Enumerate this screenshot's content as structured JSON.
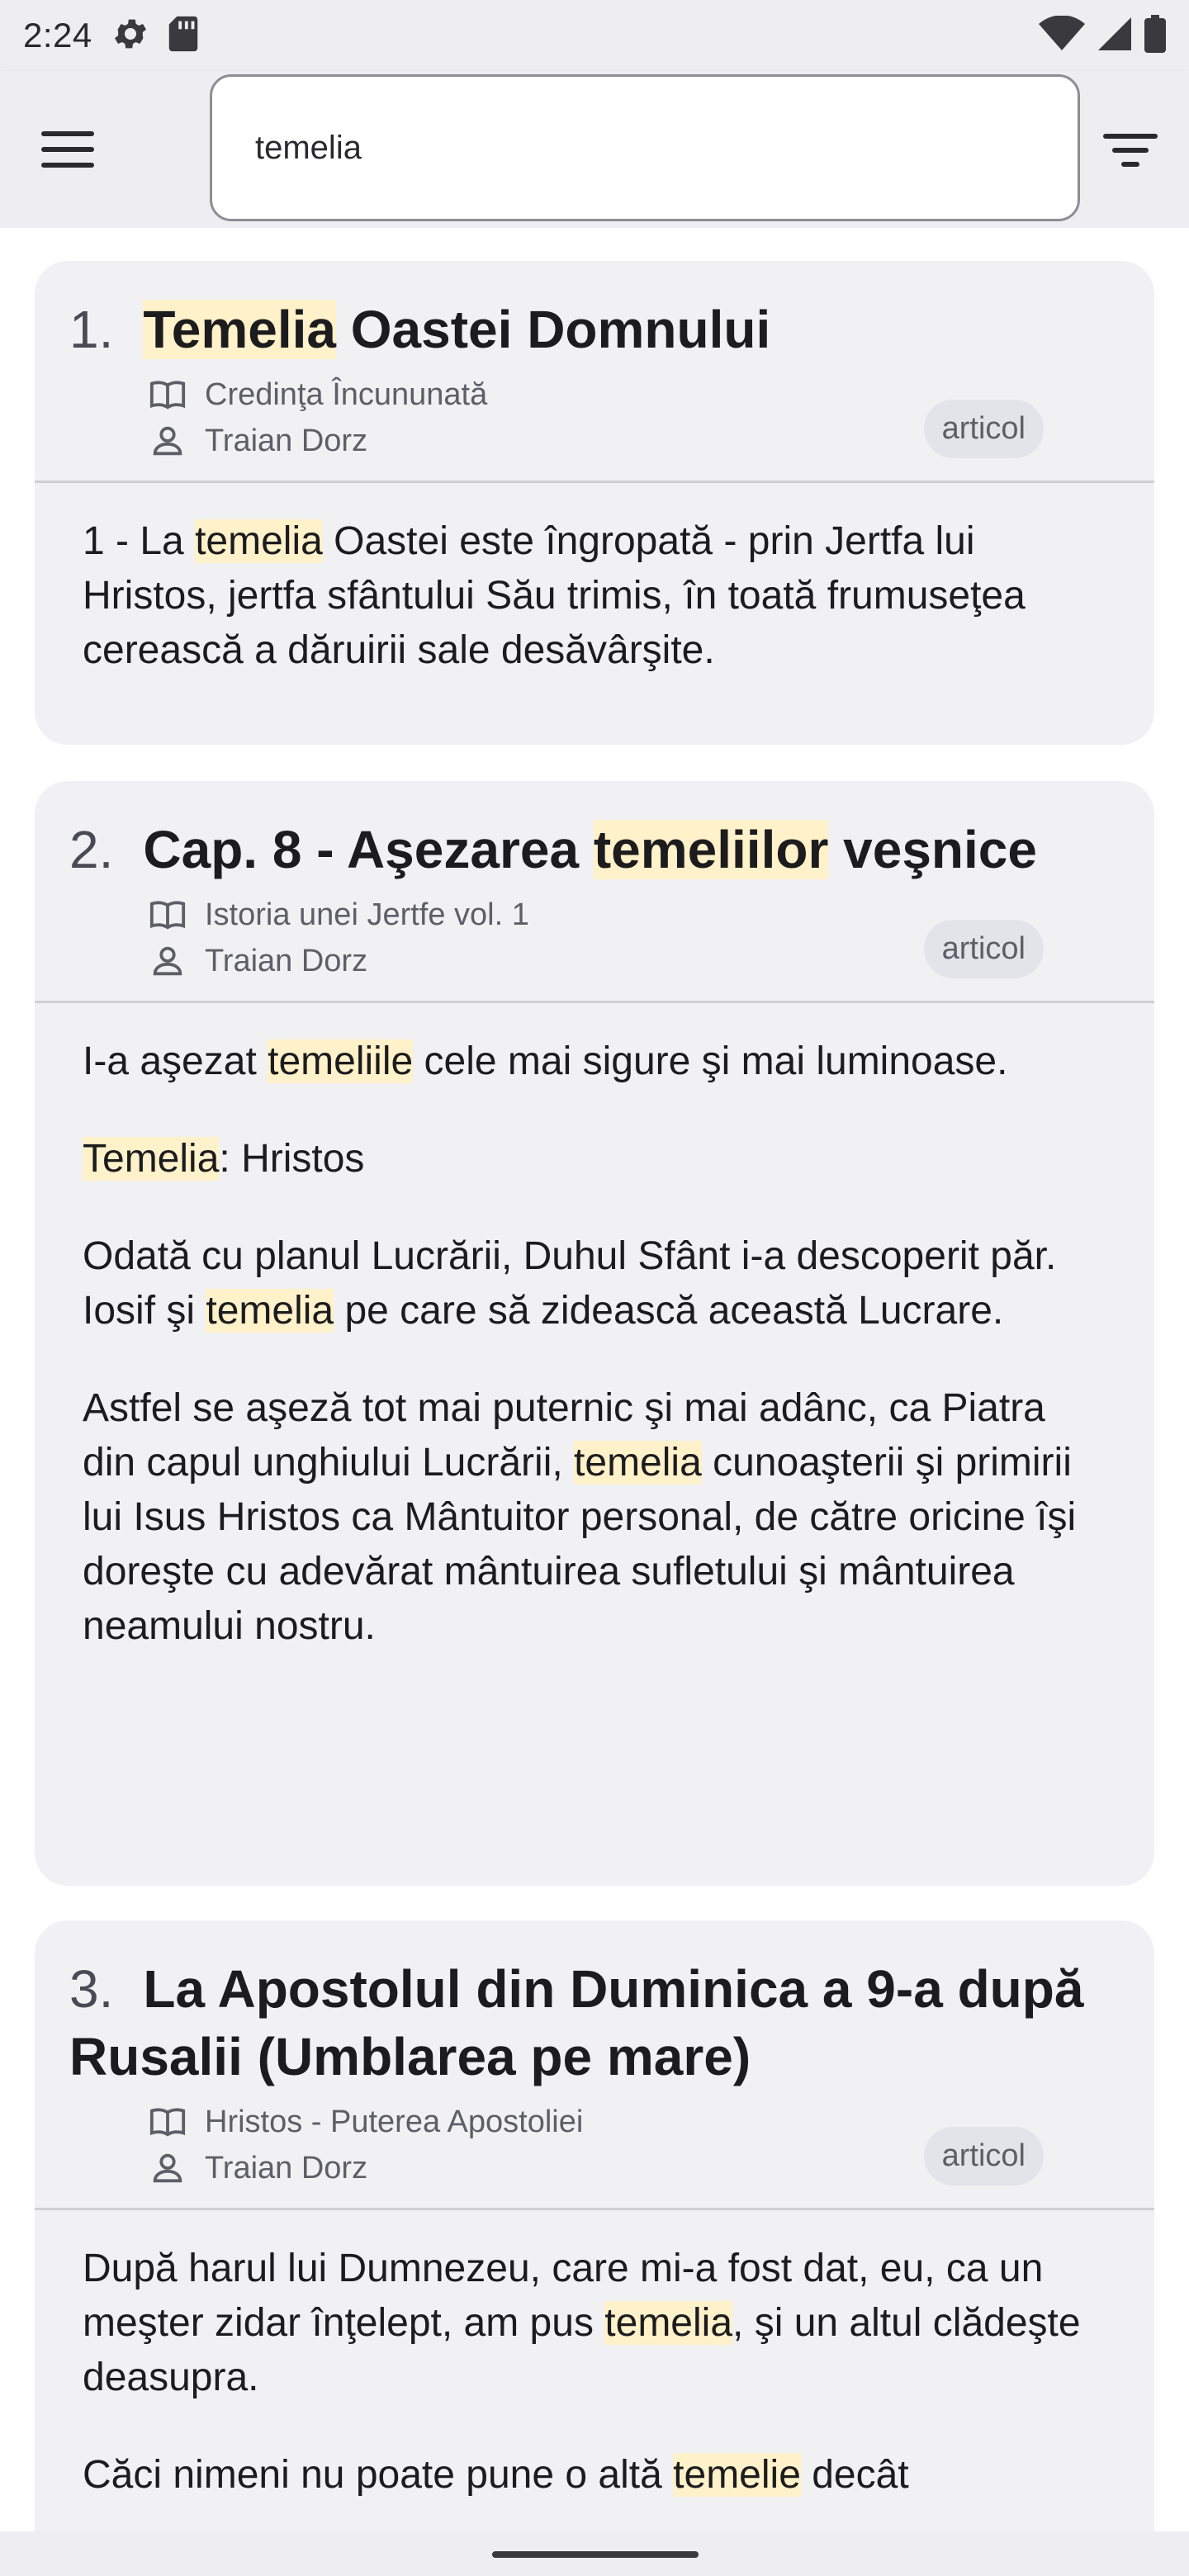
{
  "status_bar": {
    "time": "2:24",
    "left_icons": [
      "settings-gear-icon",
      "sd-card-icon"
    ],
    "right_icons": [
      "wifi-icon",
      "cell-signal-icon",
      "battery-icon"
    ]
  },
  "app_bar": {
    "menu_icon": "hamburger-menu-icon",
    "search_value": "temelia",
    "filter_icon": "filter-icon"
  },
  "results": [
    {
      "number": "1.",
      "title_parts": [
        {
          "text": "Temelia",
          "highlight": true
        },
        {
          "text": " Oastei Domnului",
          "highlight": false
        }
      ],
      "book": "Credinţa Încununată",
      "author": "Traian Dorz",
      "badge": "articol",
      "paragraphs": [
        [
          {
            "text": "1 - La ",
            "highlight": false
          },
          {
            "text": "temelia",
            "highlight": true
          },
          {
            "text": " Oastei este îngropată - prin Jertfa lui Hristos, jertfa sfântului Său trimis, în toată frumuseţea cerească a dăruirii sale desăvârşite.",
            "highlight": false
          }
        ]
      ]
    },
    {
      "number": "2.",
      "title_parts": [
        {
          "text": "Cap. 8 - Aşezarea ",
          "highlight": false
        },
        {
          "text": "temeliilor",
          "highlight": true
        },
        {
          "text": " veşnice",
          "highlight": false
        }
      ],
      "book": "Istoria unei Jertfe vol. 1",
      "author": "Traian Dorz",
      "badge": "articol",
      "paragraphs": [
        [
          {
            "text": "I-a aşezat ",
            "highlight": false
          },
          {
            "text": "temeliile",
            "highlight": true
          },
          {
            "text": " cele mai sigure şi mai luminoase.",
            "highlight": false
          }
        ],
        [
          {
            "text": "Temelia",
            "highlight": true
          },
          {
            "text": ": Hristos",
            "highlight": false
          }
        ],
        [
          {
            "text": "Odată cu planul Lucrării, Duhul Sfânt i-a descoperit păr. Iosif şi ",
            "highlight": false
          },
          {
            "text": "temelia",
            "highlight": true
          },
          {
            "text": " pe care să zidească această Lucrare.",
            "highlight": false
          }
        ],
        [
          {
            "text": "Astfel se aşeză tot mai puternic şi mai adânc, ca Piatra din capul unghiului Lucrării, ",
            "highlight": false
          },
          {
            "text": "temelia",
            "highlight": true
          },
          {
            "text": " cunoaşterii şi primirii lui Isus Hristos ca Mântuitor personal, de către oricine îşi doreşte cu adevărat mântuirea sufletului şi mântuirea neamului nostru.",
            "highlight": false
          }
        ]
      ]
    },
    {
      "number": "3.",
      "title_parts": [
        {
          "text": "La Apostolul din Duminica a 9-a după Rusalii (Umblarea pe mare)",
          "highlight": false
        }
      ],
      "book": "Hristos - Puterea Apostoliei",
      "author": "Traian Dorz",
      "badge": "articol",
      "paragraphs": [
        [
          {
            "text": "După harul lui Dumnezeu, care mi-a fost dat, eu, ca un meşter zidar înţelept, am pus ",
            "highlight": false
          },
          {
            "text": "temelia",
            "highlight": true
          },
          {
            "text": ", şi un altul clădeşte deasupra.",
            "highlight": false
          }
        ],
        [
          {
            "text": "Căci nimeni nu poate pune o altă ",
            "highlight": false
          },
          {
            "text": "temelie",
            "highlight": true
          },
          {
            "text": " decât",
            "highlight": false
          }
        ]
      ]
    }
  ],
  "colors": {
    "highlight": "#fff1c9",
    "card_background": "#f1f1f4",
    "bar_background": "#eeeef0"
  }
}
